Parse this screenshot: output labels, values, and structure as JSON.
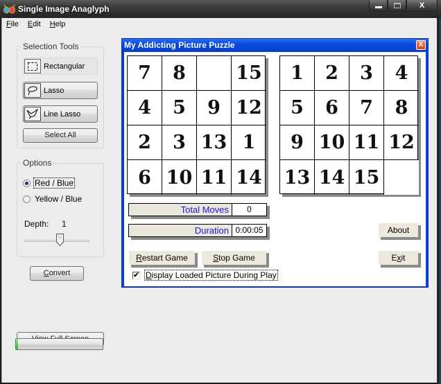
{
  "window": {
    "title": "Single Image Anaglyph",
    "caption_buttons": {
      "minimize": "minimize",
      "maximize": "maximize",
      "close": "X"
    }
  },
  "menu": [
    {
      "label": "File",
      "accel": "F",
      "rest": "ile"
    },
    {
      "label": "Edit",
      "accel": "E",
      "rest": "dit"
    },
    {
      "label": "Help",
      "accel": "H",
      "rest": "elp"
    }
  ],
  "selection_tools": {
    "title": "Selection Tools",
    "rectangular": "Rectangular",
    "lasso": "Lasso",
    "line_lasso": "Line Lasso",
    "select_all": "Select All"
  },
  "options": {
    "title": "Options",
    "radio_red_blue": "Red / Blue",
    "radio_yellow_blue": "Yellow / Blue",
    "selected": "Red / Blue",
    "depth_label": "Depth:",
    "depth_value": "1",
    "depth_slider_fraction": 0.55
  },
  "convert_button": {
    "accel": "C",
    "rest": "onvert"
  },
  "view_full_screen": "View Full Screen",
  "progress_fraction": 0.01,
  "dialog": {
    "title": "My Addicting Picture Puzzle",
    "close": "X",
    "current_board": [
      "7",
      "8",
      "",
      "15",
      "4",
      "5",
      "9",
      "12",
      "2",
      "3",
      "13",
      "1",
      "6",
      "10",
      "11",
      "14"
    ],
    "solved_board": [
      "1",
      "2",
      "3",
      "4",
      "5",
      "6",
      "7",
      "8",
      "9",
      "10",
      "11",
      "12",
      "13",
      "14",
      "15",
      ""
    ],
    "total_moves_label": "Total Moves",
    "total_moves_value": "0",
    "duration_label": "Duration",
    "duration_value": "0:00:05",
    "restart": {
      "accel": "R",
      "rest": "estart Game"
    },
    "stop": {
      "accel": "S",
      "rest": "top Game"
    },
    "about": "About",
    "exit": {
      "pre": "E",
      "accel": "x",
      "rest": "it"
    },
    "display_picture_checkbox": {
      "accel": "D",
      "rest": "isplay Loaded Picture During Play",
      "checked": true
    }
  }
}
